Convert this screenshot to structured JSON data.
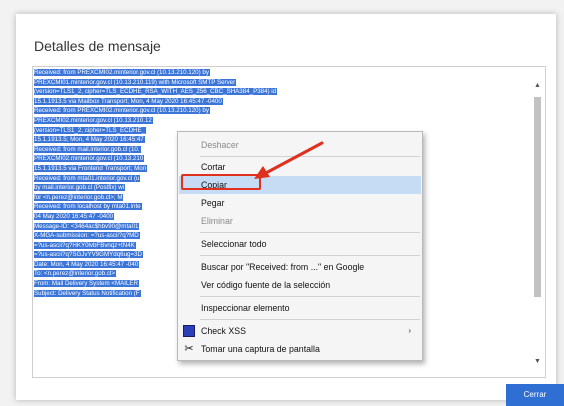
{
  "dialog": {
    "title": "Detalles de mensaje",
    "close_button_label": "Cerrar"
  },
  "headers": [
    "Received: from PREXCMI02.minterior.gov.cl (10.13.210.120) by",
    " PREXCMI01.minterior.gov.cl (10.13.210.119) with Microsoft SMTP Server",
    " (version=TLS1_2, cipher=TLS_ECDHE_RSA_WITH_AES_256_CBC_SHA384_P384) id",
    " 15.1.1913.5 via Mailbox Transport; Mon, 4 May 2020 16:45:47 -0400",
    "Received: from PREXCMI02.minterior.gov.cl (10.13.210.120) by",
    " PREXCMI02.minterior.gov.cl (10.13.210.12",
    " (version=TLS1_2, cipher=TLS_ECDHE_",
    " 15.1.1913.5; Mon, 4 May 2020 16:45:47",
    "Received: from mail.interior.gob.cl (10.",
    " PREXCMI02.minterior.gov.cl (10.13.210",
    " 15.1.1913.5 via Frontend Transport; Mon",
    "Received: from mta01.interior.gov.cl (u",
    "          by mail.interior.gob.cl (Postfix) wi",
    "          for <n.perez@interior.gob.cl>; M",
    "Received: from localhost by mta01.inte",
    "  04 May 2020 16:45:47 -0400",
    "Message-ID: <3464ac$hbv90@mta01",
    "X-MGA-submission: =?us-ascii?q?MD",
    " =?us-ascii?q?HKY0lvbFBvnqz+tN4K",
    " =?us-ascii?q?SGJvYV9GMYdq6ug=3D",
    "Date: Mon, 4 May 2020 16:45:47 -040",
    "To: <n.perez@interior.gob.cl>",
    "From: Mail Delivery System <MAILER",
    "Subject: Delivery Status Notification (F"
  ],
  "context_menu": {
    "undo": "Deshacer",
    "cut": "Cortar",
    "copy": "Copiar",
    "paste": "Pegar",
    "delete": "Eliminar",
    "select_all": "Seleccionar todo",
    "search_google": "Buscar por \"Received: from ...\" en Google",
    "view_source": "Ver código fuente de la selección",
    "inspect": "Inspeccionar elemento",
    "check_xss": "Check XSS",
    "screenshot": "Tomar una captura de pantalla"
  },
  "colors": {
    "selection": "#3b75d8",
    "primary_button": "#2f6fd4",
    "highlight_item": "#c6dcf5",
    "annotation_red": "#e0301e"
  },
  "icons": {
    "scroll_up": "chevron-up-icon",
    "scroll_down": "chevron-down-icon",
    "submenu_arrow": "chevron-right-icon",
    "check_xss": "xss-extension-icon",
    "screenshot": "scissors-icon"
  }
}
